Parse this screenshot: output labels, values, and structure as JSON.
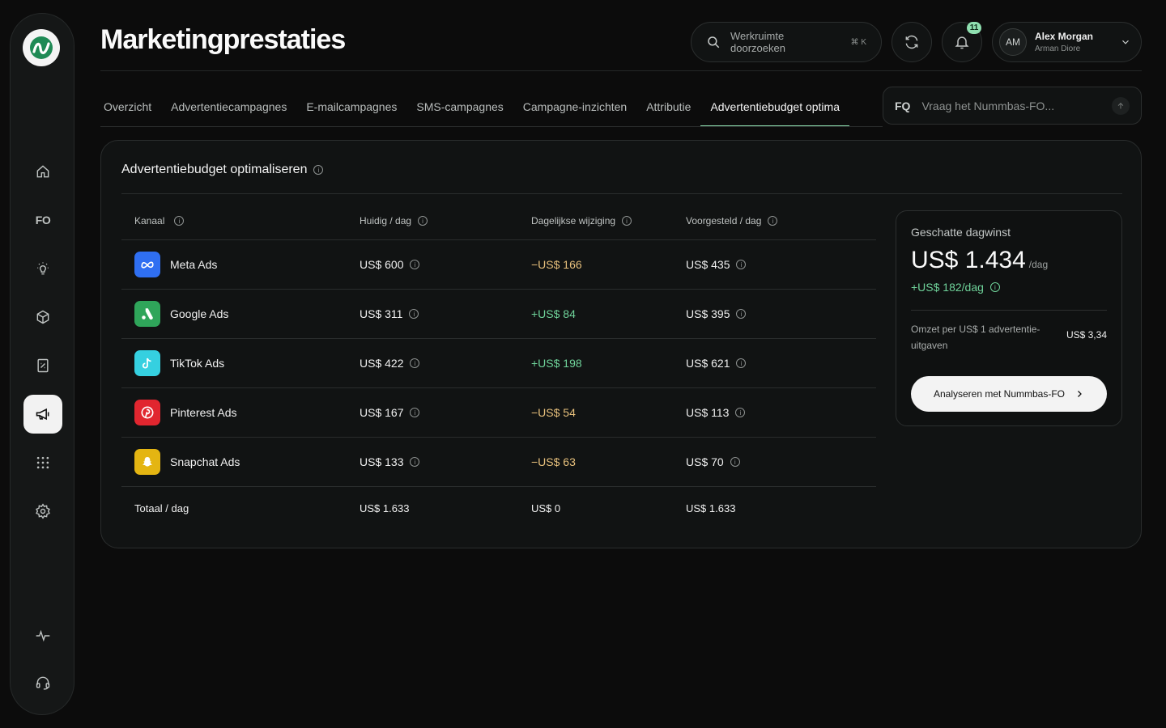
{
  "page": {
    "title": "Marketingprestaties"
  },
  "search": {
    "placeholder": "Werkruimte doorzoeken",
    "shortcut": "⌘ K"
  },
  "notifications": {
    "count": "11"
  },
  "user": {
    "initials": "AM",
    "name": "Alex Morgan",
    "org": "Arman Diore"
  },
  "sidebar": {
    "logo": "nummbas-logo",
    "items": [
      {
        "name": "home",
        "icon": "home-icon"
      },
      {
        "name": "fo",
        "label": "FO"
      },
      {
        "name": "insights",
        "icon": "lightbulb-icon"
      },
      {
        "name": "products",
        "icon": "box-icon"
      },
      {
        "name": "reports",
        "icon": "report-icon"
      },
      {
        "name": "marketing",
        "icon": "megaphone-icon",
        "active": true
      },
      {
        "name": "apps",
        "icon": "grid-icon"
      },
      {
        "name": "settings",
        "icon": "gear-icon"
      },
      {
        "name": "activity",
        "icon": "pulse-icon"
      },
      {
        "name": "support",
        "icon": "headset-icon"
      }
    ]
  },
  "tabs": [
    {
      "label": "Overzicht"
    },
    {
      "label": "Advertentiecampagnes"
    },
    {
      "label": "E-mailcampagnes"
    },
    {
      "label": "SMS-campagnes"
    },
    {
      "label": "Campagne-inzichten"
    },
    {
      "label": "Attributie"
    },
    {
      "label": "Advertentiebudget optima",
      "active": true
    }
  ],
  "ask": {
    "logo": "FQ",
    "placeholder": "Vraag het Nummbas-FO..."
  },
  "card": {
    "title": "Advertentiebudget optimaliseren",
    "columns": [
      "Kanaal",
      "Huidig / dag",
      "Dagelijkse wijziging",
      "Voorgesteld / dag"
    ],
    "rows": [
      {
        "channel": "Meta Ads",
        "color": "#2f6ff2",
        "current": "US$ 600",
        "change": "−US$ 166",
        "trend": "neg",
        "suggested": "US$ 435"
      },
      {
        "channel": "Google Ads",
        "color": "#2fa55a",
        "current": "US$ 311",
        "change": "+US$ 84",
        "trend": "pos",
        "suggested": "US$ 395"
      },
      {
        "channel": "TikTok Ads",
        "color": "#35d0e0",
        "current": "US$ 422",
        "change": "+US$ 198",
        "trend": "pos",
        "suggested": "US$ 621"
      },
      {
        "channel": "Pinterest Ads",
        "color": "#e1262f",
        "current": "US$ 167",
        "change": "−US$ 54",
        "trend": "neg",
        "suggested": "US$ 113"
      },
      {
        "channel": "Snapchat Ads",
        "color": "#e4b512",
        "current": "US$ 133",
        "change": "−US$ 63",
        "trend": "neg",
        "suggested": "US$ 70"
      }
    ],
    "total": {
      "label": "Totaal / dag",
      "current": "US$ 1.633",
      "change": "US$ 0",
      "suggested": "US$ 1.633"
    }
  },
  "profit": {
    "label": "Geschatte dagwinst",
    "value": "US$ 1.434",
    "unit": "/dag",
    "gain": "+US$ 182/dag",
    "roas_label": "Omzet per US$ 1 advertentie-uitgaven",
    "roas_value": "US$ 3,34",
    "cta": "Analyseren met Nummbas-FO"
  }
}
